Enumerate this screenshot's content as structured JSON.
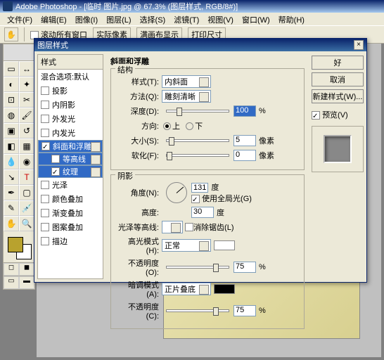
{
  "titlebar": "Adobe Photoshop - [临时 图片.jpg @ 67.3% (图层样式, RGB/8#)]",
  "menu": {
    "file": "文件(F)",
    "edit": "编辑(E)",
    "image": "图像(I)",
    "layer": "图层(L)",
    "select": "选择(S)",
    "filter": "滤镜(T)",
    "view": "视图(V)",
    "window": "窗口(W)",
    "help": "帮助(H)"
  },
  "opt": {
    "scroll": "滚动所有窗口",
    "actual": "实际像素",
    "fit": "满画布显示",
    "print": "打印尺寸"
  },
  "dialog": {
    "title": "图层样式",
    "styles_header": "样式",
    "blend": "混合选项:默认",
    "list": [
      "投影",
      "内阴影",
      "外发光",
      "内发光",
      "斜面和浮雕",
      "等高线",
      "纹理",
      "光泽",
      "颜色叠加",
      "渐变叠加",
      "图案叠加",
      "描边"
    ],
    "ok": "好",
    "cancel": "取消",
    "new": "新建样式(W)...",
    "preview": "预览(V)"
  },
  "bevel": {
    "title": "斜面和浮雕",
    "structure": "结构",
    "style_l": "样式(T):",
    "style_v": "内斜面",
    "tech_l": "方法(Q):",
    "tech_v": "雕刻清晰",
    "depth_l": "深度(D):",
    "depth_v": "100",
    "pct": "%",
    "dir_l": "方向:",
    "up": "上",
    "down": "下",
    "size_l": "大小(S):",
    "size_v": "5",
    "px": "像素",
    "soft_l": "软化(F):",
    "soft_v": "0",
    "shading": "阴影",
    "angle_l": "角度(N):",
    "angle_v": "131",
    "deg": "度",
    "global": "使用全局光(G)",
    "alt_l": "高度:",
    "alt_v": "30",
    "gloss_l": "光泽等高线:",
    "aa": "消除锯齿(L)",
    "hi_l": "高光模式(H):",
    "hi_v": "正常",
    "op_l": "不透明度(O):",
    "op_v": "75",
    "sh_l": "暗调模式(A):",
    "sh_v": "正片叠底",
    "op2_l": "不透明度(C):",
    "op2_v": "75"
  }
}
